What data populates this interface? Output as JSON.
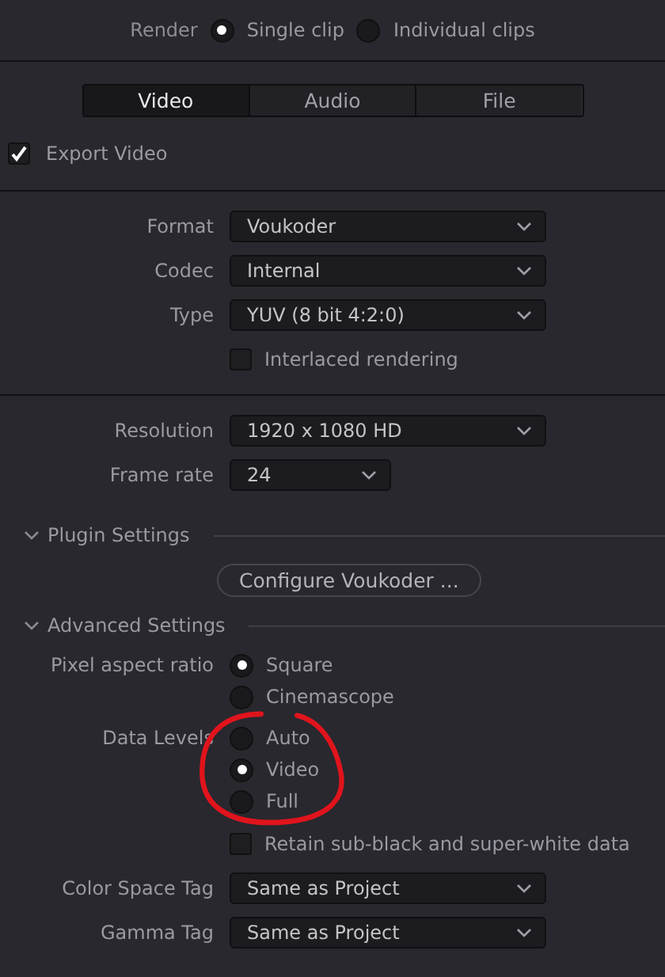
{
  "render": {
    "label": "Render",
    "options": [
      {
        "label": "Single clip",
        "selected": true
      },
      {
        "label": "Individual clips",
        "selected": false
      }
    ]
  },
  "tabs": [
    {
      "label": "Video",
      "selected": true
    },
    {
      "label": "Audio",
      "selected": false
    },
    {
      "label": "File",
      "selected": false
    }
  ],
  "export_video": {
    "label": "Export Video",
    "checked": true
  },
  "groups": [
    {
      "rows": [
        {
          "kind": "select",
          "label": "Format",
          "value": "Voukoder"
        },
        {
          "kind": "select",
          "label": "Codec",
          "value": "Internal"
        },
        {
          "kind": "select",
          "label": "Type",
          "value": "YUV (8 bit 4:2:0)"
        },
        {
          "kind": "checkbox",
          "label": "Interlaced rendering",
          "checked": false
        }
      ]
    },
    {
      "rows": [
        {
          "kind": "select",
          "label": "Resolution",
          "value": "1920 x 1080 HD"
        },
        {
          "kind": "short_select",
          "label": "Frame rate",
          "value": "24"
        }
      ]
    }
  ],
  "sections": [
    {
      "title": "Plugin Settings",
      "expanded": true,
      "rows": [
        {
          "kind": "button",
          "label": "Configure Voukoder ..."
        }
      ]
    },
    {
      "title": "Advanced Settings",
      "expanded": true,
      "rows": [
        {
          "kind": "radio",
          "label": "Pixel aspect ratio",
          "circled": false,
          "options": [
            {
              "label": "Square",
              "selected": true
            },
            {
              "label": "Cinemascope",
              "selected": false
            }
          ]
        },
        {
          "kind": "radio",
          "label": "Data Levels",
          "circled": true,
          "options": [
            {
              "label": "Auto",
              "selected": false
            },
            {
              "label": "Video",
              "selected": true
            },
            {
              "label": "Full",
              "selected": false
            }
          ]
        },
        {
          "kind": "checkbox",
          "label": "Retain sub-black and super-white data",
          "checked": false
        },
        {
          "kind": "select",
          "label": "Color Space Tag",
          "value": "Same as Project"
        },
        {
          "kind": "select",
          "label": "Gamma Tag",
          "value": "Same as Project"
        }
      ]
    }
  ]
}
